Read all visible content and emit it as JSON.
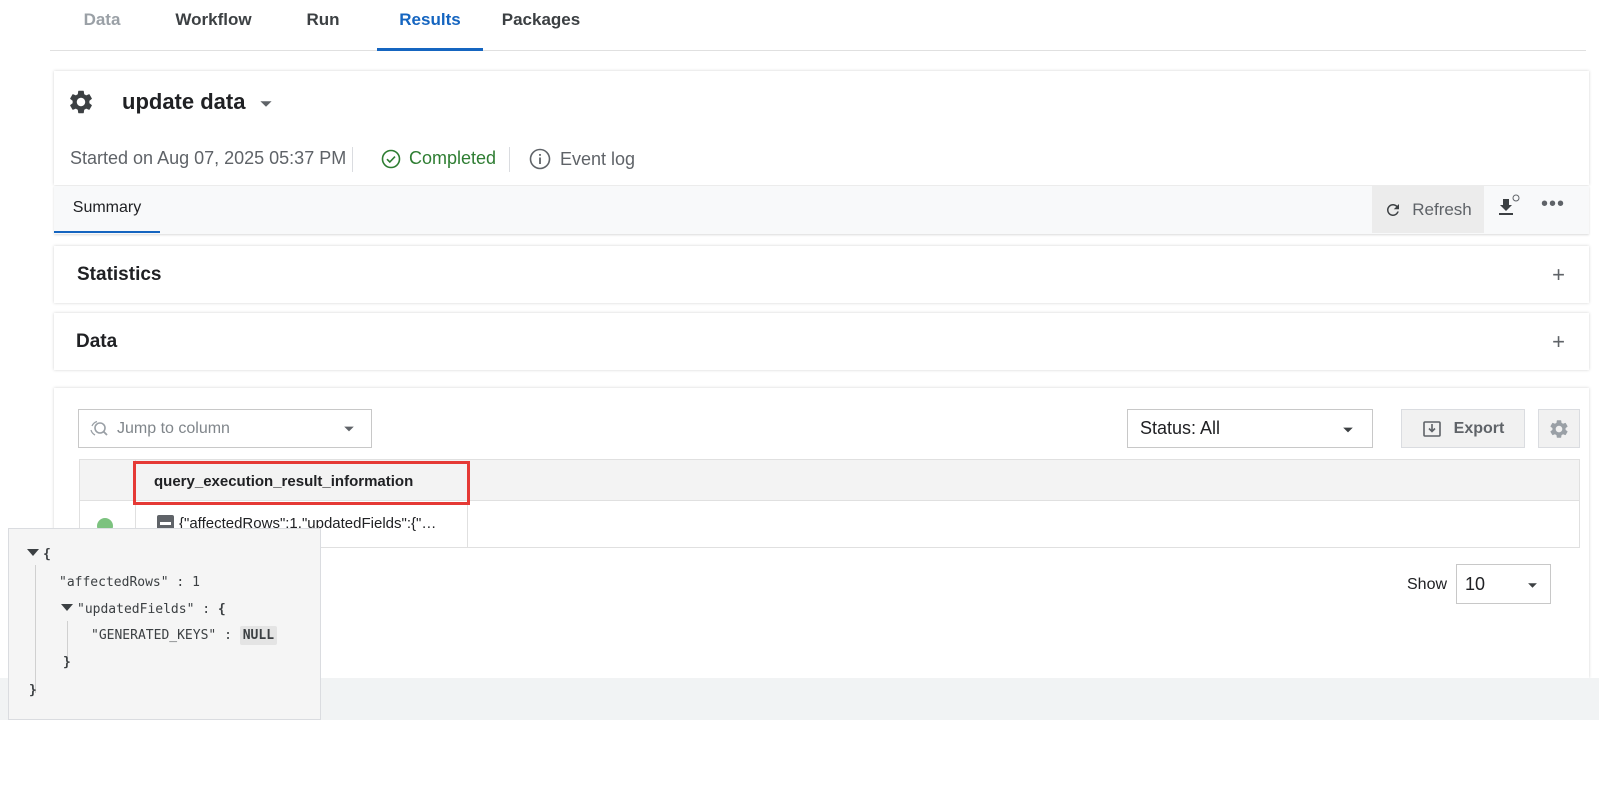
{
  "top_tabs": [
    {
      "label": "Data",
      "state": "disabled"
    },
    {
      "label": "Workflow",
      "state": "normal"
    },
    {
      "label": "Run",
      "state": "normal"
    },
    {
      "label": "Results",
      "state": "active"
    },
    {
      "label": "Packages",
      "state": "normal"
    }
  ],
  "header": {
    "title": "update data",
    "started": "Started on Aug 07, 2025 05:37 PM",
    "status": "Completed",
    "event_log": "Event log"
  },
  "subtabs": {
    "summary": "Summary",
    "refresh": "Refresh"
  },
  "panels": {
    "statistics": "Statistics",
    "data": "Data",
    "expand_symbol": "+"
  },
  "data_view": {
    "jump_placeholder": "Jump to column",
    "status_filter": "Status: All",
    "export": "Export",
    "column_header": "query_execution_result_information",
    "cell_value": "{\"affectedRows\":1,\"updatedFields\":{\"…",
    "show_label": "Show",
    "show_value": "10"
  },
  "json_view": {
    "open_brace": "{",
    "close_brace": "}",
    "affected_key": "\"affectedRows\"",
    "affected_value": "1",
    "updated_key": "\"updatedFields\"",
    "generated_key": "\"GENERATED_KEYS\"",
    "generated_value": "NULL",
    "colon": ":"
  },
  "colors": {
    "accent": "#1565c0",
    "success": "#2e7d32",
    "status_dot": "#7cc27f",
    "highlight": "#e53935"
  }
}
